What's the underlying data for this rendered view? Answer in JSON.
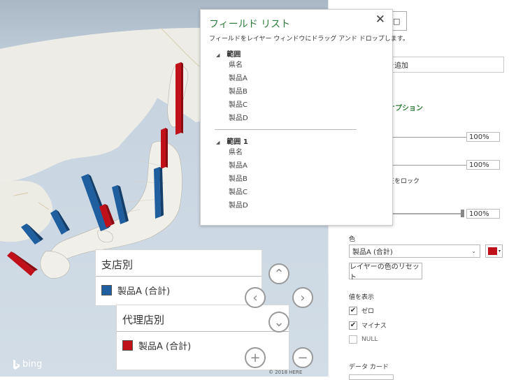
{
  "map": {
    "legend1": {
      "title": "支店別",
      "series": "製品A (合計)",
      "color": "#1f5f9f"
    },
    "legend2": {
      "title": "代理店別",
      "series": "製品A (合計)",
      "color": "#c0101a"
    },
    "nav": {
      "up": "⌃",
      "left": "‹",
      "right": "›",
      "down": "⌄",
      "zoom_in": "+",
      "zoom_out": "−"
    },
    "bing_label": "bing",
    "copyright": "© 2018 HERE"
  },
  "field_list": {
    "title": "フィールド リスト",
    "close": "✕",
    "description": "フィールドをレイヤー ウィンドウにドラッグ アンド ドロップします。",
    "groups": [
      {
        "name": "範囲",
        "items": [
          "県名",
          "製品A",
          "製品B",
          "製品C",
          "製品D"
        ]
      },
      {
        "name": "範囲 1",
        "items": [
          "県名",
          "製品A",
          "製品B",
          "製品C",
          "製品D"
        ]
      }
    ]
  },
  "panel": {
    "top_button": "□",
    "field_text": "を追加",
    "options_label": "オプション",
    "slider_values": [
      "100%",
      "100%",
      "100%"
    ],
    "lock_label": "正をロック",
    "color_label": "色",
    "color_select": "製品A (合計)",
    "color_value": "#c0101a",
    "reset_button": "レイヤーの色のリセット",
    "show_values_label": "値を表示",
    "checks": [
      {
        "label": "ゼロ",
        "checked": "✔"
      },
      {
        "label": "マイナス",
        "checked": "✔"
      },
      {
        "label": "NULL",
        "checked": ""
      }
    ],
    "data_card_label": "データ カード"
  }
}
